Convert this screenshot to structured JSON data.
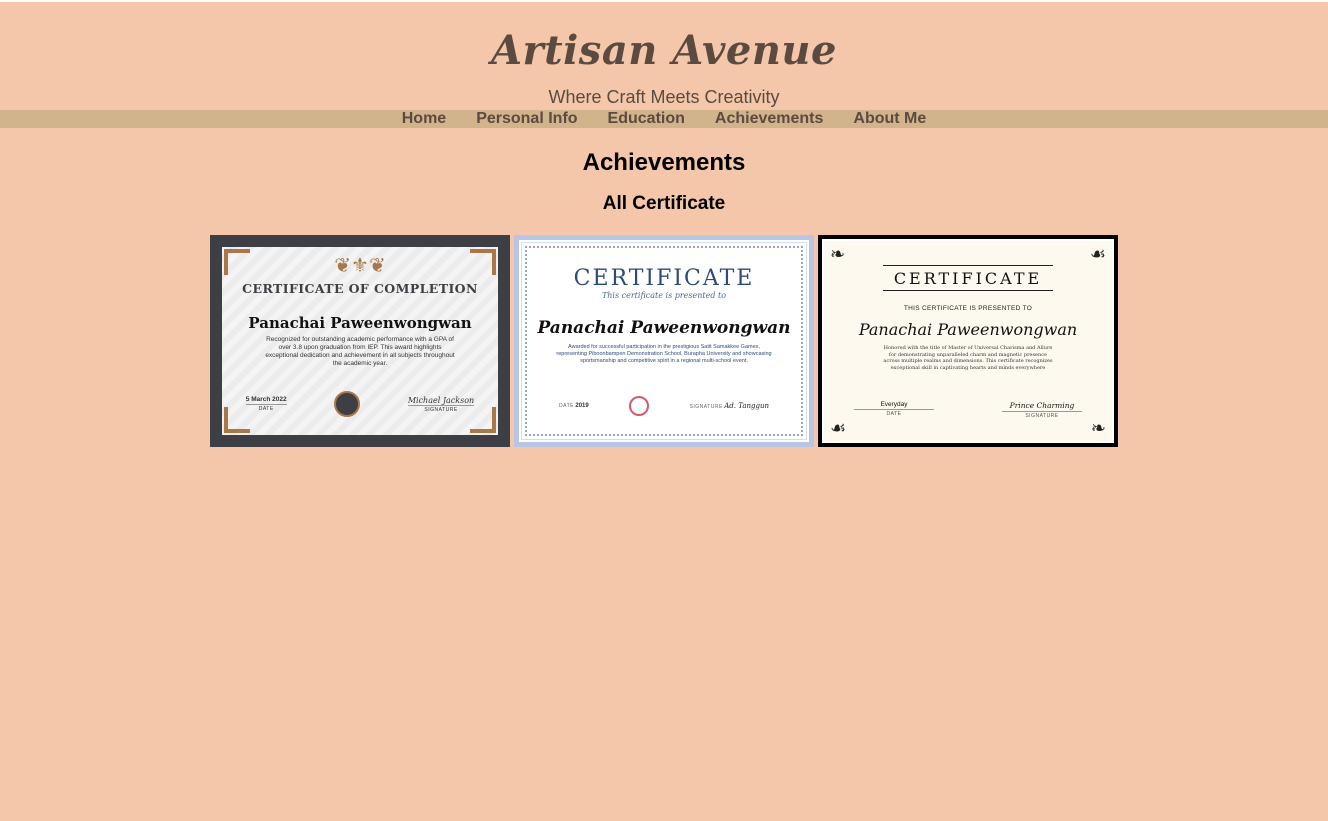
{
  "header": {
    "site_title": "Artisan Avenue",
    "tagline": "Where Craft Meets Creativity"
  },
  "nav": {
    "items": [
      "Home",
      "Personal Info",
      "Education",
      "Achievements",
      "About Me"
    ]
  },
  "main": {
    "page_heading": "Achievements",
    "section_heading": "All Certificate"
  },
  "certificates": [
    {
      "title": "CERTIFICATE OF COMPLETION",
      "name": "Panachai Paweenwongwan",
      "body": "Recognized for outstanding academic performance with a GPA of over 3.8 upon graduation from IEP. This award highlights exceptional dedication and achievement in all subjects throughout the academic year.",
      "date": "5 March 2022",
      "date_label": "DATE",
      "signature": "Michael Jackson",
      "signature_label": "SIGNATURE"
    },
    {
      "title": "CERTIFICATE",
      "subtitle": "This certificate is presented to",
      "name": "Panachai Paweenwongwan",
      "body": "Awarded for successful participation in the prestigious Satit Samakkee Games, representing Piboonbampen Demonstration School, Burapha University and showcasing sportsmanship and competitive spirit in a regional multi-school event.",
      "date": "2019",
      "date_label": "DATE",
      "signature": "Ad. Tanggun",
      "signature_label": "SIGNATURE"
    },
    {
      "title": "CERTIFICATE",
      "subtitle": "THIS CERTIFICATE IS PRESENTED TO",
      "name": "Panachai Paweenwongwan",
      "body": "Honored with the title of Master of Universal Charisma and Allure for demonstrating unparalleled charm and magnetic presence across multiple realms and dimensions. This certificate recognizes exceptional skill in captivating hearts and minds everywhere",
      "date": "Everyday",
      "date_label": "DATE",
      "signature": "Prince Charming",
      "signature_label": "SIGNATURE"
    }
  ]
}
